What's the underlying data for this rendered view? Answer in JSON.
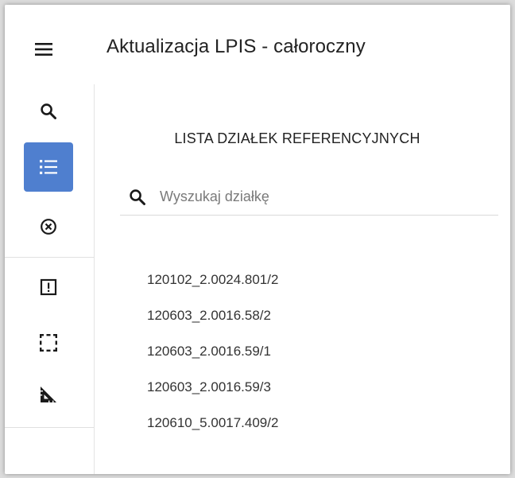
{
  "header": {
    "title": "Aktualizacja LPIS - całoroczny",
    "menu_icon": "hamburger-menu-icon"
  },
  "sidebar": {
    "items": [
      {
        "icon": "search-icon",
        "active": false
      },
      {
        "icon": "list-icon",
        "active": true
      },
      {
        "icon": "close-circle-icon",
        "active": false
      },
      {
        "icon": "alert-box-icon",
        "active": false
      },
      {
        "icon": "selection-icon",
        "active": false
      },
      {
        "icon": "ruler-triangle-icon",
        "active": false
      }
    ]
  },
  "panel": {
    "title": "LISTA DZIAŁEK REFERENCYJNYCH",
    "search": {
      "placeholder": "Wyszukaj działkę",
      "value": ""
    },
    "plots": [
      "120102_2.0024.801/2",
      "120603_2.0016.58/2",
      "120603_2.0016.59/1",
      "120603_2.0016.59/3",
      "120610_5.0017.409/2"
    ]
  },
  "colors": {
    "accent": "#4f7fcf",
    "text": "#222222",
    "icon": "#1a1a1a"
  }
}
